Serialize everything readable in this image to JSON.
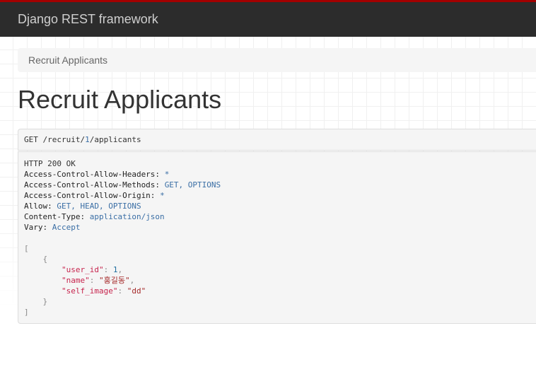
{
  "navbar": {
    "brand": "Django REST framework"
  },
  "breadcrumb": {
    "items": [
      "Recruit Applicants"
    ]
  },
  "page": {
    "title": "Recruit Applicants"
  },
  "request": {
    "method": "GET",
    "path_prefix": "/recruit/",
    "path_id": "1",
    "path_suffix": "/applicants"
  },
  "response": {
    "status": "HTTP 200 OK",
    "headers": [
      {
        "name": "Access-Control-Allow-Headers:",
        "value": "*"
      },
      {
        "name": "Access-Control-Allow-Methods:",
        "value": "GET, OPTIONS"
      },
      {
        "name": "Access-Control-Allow-Origin:",
        "value": "*"
      },
      {
        "name": "Allow:",
        "value": "GET, HEAD, OPTIONS"
      },
      {
        "name": "Content-Type:",
        "value": "application/json"
      },
      {
        "name": "Vary:",
        "value": "Accept"
      }
    ],
    "body": {
      "open_bracket": "[",
      "open_brace": "{",
      "fields": [
        {
          "key": "\"user_id\"",
          "value": "1",
          "type": "number"
        },
        {
          "key": "\"name\"",
          "value": "\"홍길동\"",
          "type": "string"
        },
        {
          "key": "\"self_image\"",
          "value": "\"dd\"",
          "type": "string"
        }
      ],
      "close_brace": "}",
      "close_bracket": "]"
    }
  },
  "colors": {
    "navbar_bg": "#2c2c2c",
    "navbar_accent": "#a30000",
    "json_key": "#c7254e",
    "json_number": "#1f6f9f",
    "header_value": "#3a6ea5"
  }
}
